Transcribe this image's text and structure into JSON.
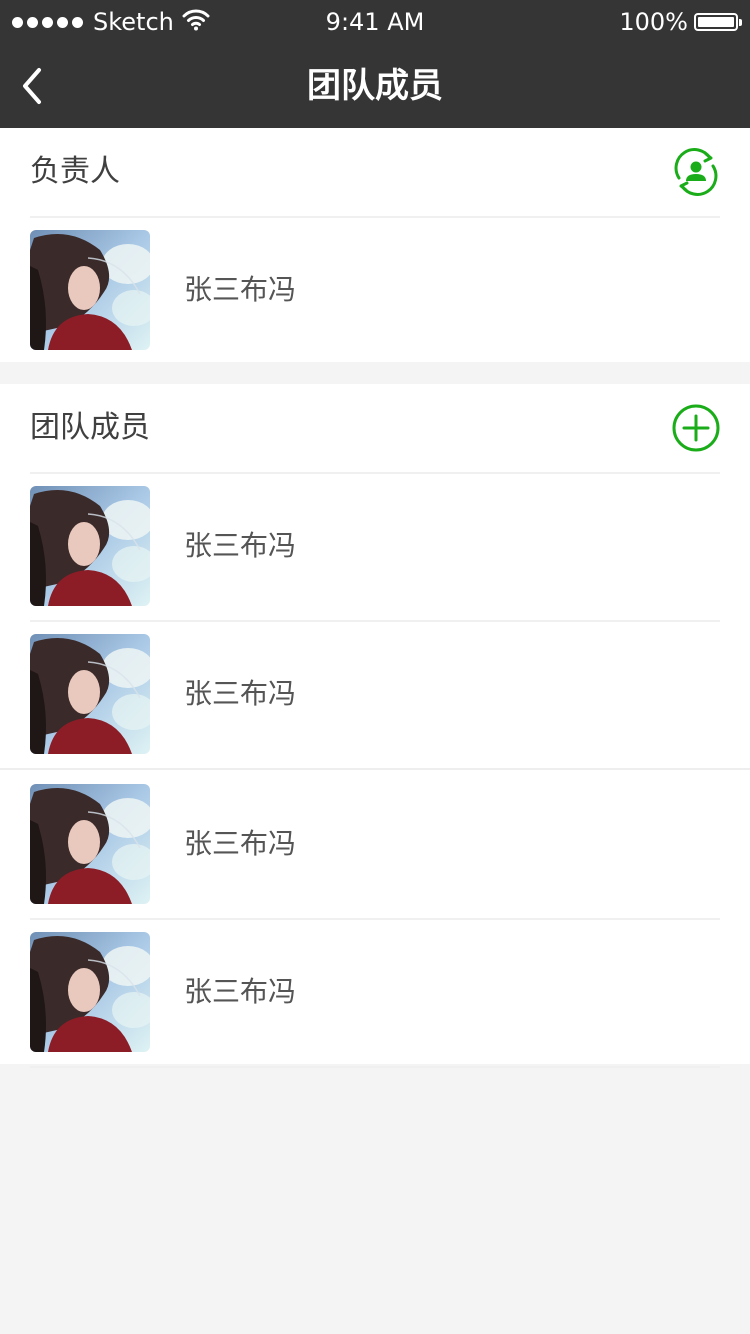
{
  "status_bar": {
    "carrier": "Sketch",
    "time": "9:41 AM",
    "battery": "100%",
    "signal_icon": "signal-dots-icon",
    "wifi_icon": "wifi-icon",
    "battery_icon": "battery-icon"
  },
  "nav": {
    "title": "团队成员",
    "back_icon": "chevron-left-icon"
  },
  "leader_section": {
    "title": "负责人",
    "action_icon": "switch-user-icon",
    "members": [
      {
        "name": "张三布冯",
        "avatar": "avatar-photo"
      }
    ]
  },
  "team_section": {
    "title": "团队成员",
    "action_icon": "add-circle-icon",
    "members": [
      {
        "name": "张三布冯",
        "avatar": "avatar-photo"
      },
      {
        "name": "张三布冯",
        "avatar": "avatar-photo"
      },
      {
        "name": "张三布冯",
        "avatar": "avatar-photo"
      },
      {
        "name": "张三布冯",
        "avatar": "avatar-photo"
      }
    ]
  },
  "colors": {
    "bar_background": "#353535",
    "accent_green": "#1aad19",
    "page_background": "#f4f4f4",
    "text_primary": "#404040"
  }
}
